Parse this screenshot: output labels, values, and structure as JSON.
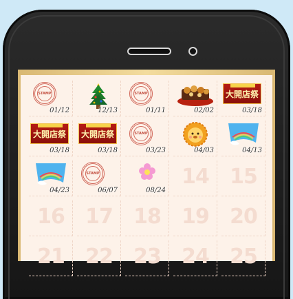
{
  "stamp_text": "STAMP",
  "banner_text": "大開店祭",
  "calendar": {
    "cells": [
      {
        "type": "stamp",
        "date": "01/12"
      },
      {
        "type": "tree",
        "date": "12/13"
      },
      {
        "type": "stamp",
        "date": "01/11"
      },
      {
        "type": "food",
        "date": "02/02"
      },
      {
        "type": "banner",
        "date": "03/18"
      },
      {
        "type": "banner",
        "date": "03/18"
      },
      {
        "type": "banner",
        "date": "03/18"
      },
      {
        "type": "stamp",
        "date": "03/23"
      },
      {
        "type": "lion",
        "date": "04/03"
      },
      {
        "type": "rainbow",
        "date": "04/13"
      },
      {
        "type": "rainbow",
        "date": "04/23"
      },
      {
        "type": "stamp",
        "date": "06/07"
      },
      {
        "type": "flower",
        "date": "08/24"
      },
      {
        "type": "empty",
        "number": "14"
      },
      {
        "type": "empty",
        "number": "15"
      },
      {
        "type": "empty",
        "number": "16"
      },
      {
        "type": "empty",
        "number": "17"
      },
      {
        "type": "empty",
        "number": "18"
      },
      {
        "type": "empty",
        "number": "19"
      },
      {
        "type": "empty",
        "number": "20"
      },
      {
        "type": "empty",
        "number": "21"
      },
      {
        "type": "empty",
        "number": "22"
      },
      {
        "type": "empty",
        "number": "23"
      },
      {
        "type": "empty",
        "number": "24"
      },
      {
        "type": "empty",
        "number": "25"
      }
    ]
  },
  "colors": {
    "background": "#cfe9f7",
    "phone_body": "#1c1c1c",
    "frame_gold": "#e9cd8a",
    "board": "#fdf2e9",
    "stamp_red": "#d1685a",
    "placeholder_number": "#f4dcd0"
  }
}
